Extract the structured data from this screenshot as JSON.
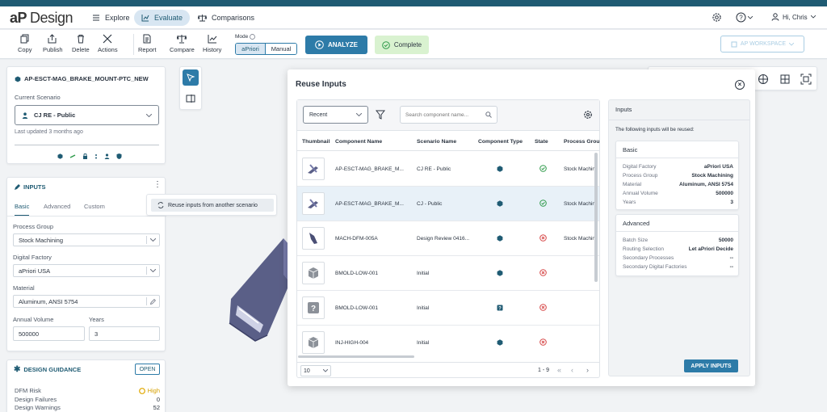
{
  "app": {
    "logo_mark": "aP",
    "logo_text": "Design",
    "nav": [
      {
        "label": "Explore"
      },
      {
        "label": "Evaluate"
      },
      {
        "label": "Comparisons"
      }
    ],
    "user_greeting": "Hi, Chris"
  },
  "toolbar": {
    "copy": "Copy",
    "publish": "Publish",
    "delete": "Delete",
    "actions": "Actions",
    "report": "Report",
    "compare": "Compare",
    "history": "History",
    "mode_label": "Mode",
    "mode_apriori": "aPriori",
    "mode_manual": "Manual",
    "analyze": "ANALYZE",
    "complete": "Complete",
    "workspace": "AP WORKSPACE"
  },
  "left": {
    "component_name": "AP-ESCT-MAG_BRAKE_MOUNT-PTC_NEW",
    "current_scenario_label": "Current Scenario",
    "scenario_value": "CJ RE - Public",
    "last_updated": "Last updated 3 months ago",
    "inputs_title": "INPUTS",
    "tabs": [
      "Basic",
      "Advanced",
      "Custom"
    ],
    "process_group_label": "Process Group",
    "process_group_value": "Stock Machining",
    "digital_factory_label": "Digital Factory",
    "digital_factory_value": "aPriori USA",
    "material_label": "Material",
    "material_value": "Aluminum, ANSI 5754",
    "annual_volume_label": "Annual Volume",
    "annual_volume_value": "500000",
    "years_label": "Years",
    "years_value": "3",
    "reuse_menu_item": "Reuse inputs from another scenario",
    "guidance_title": "DESIGN GUIDANCE",
    "guidance_open": "OPEN",
    "dfm_risk_label": "DFM Risk",
    "dfm_risk_value": "High",
    "design_failures_label": "Design Failures",
    "design_failures_value": "0",
    "design_warnings_label": "Design Warnings",
    "design_warnings_value": "52"
  },
  "modal": {
    "title": "Reuse Inputs",
    "filter_select": "Recent",
    "search_placeholder": "Search component name...",
    "columns": [
      "Thumbnail",
      "Component Name",
      "Scenario Name",
      "Component Type",
      "State",
      "Process Group"
    ],
    "rows": [
      {
        "name": "AP-ESCT-MAG_BRAKE_M...",
        "scenario": "CJ RE - Public",
        "state": "ok",
        "process": "Stock Machining",
        "thumb": "bracket-icon"
      },
      {
        "name": "AP-ESCT-MAG_BRAKE_M...",
        "scenario": "CJ - Public",
        "state": "ok",
        "process": "Stock Machining",
        "thumb": "bracket-icon"
      },
      {
        "name": "MACH-DFM-005A",
        "scenario": "Design Review 0416...",
        "state": "error",
        "process": "Stock Machining",
        "thumb": "part-icon"
      },
      {
        "name": "BMOLD-LOW-001",
        "scenario": "Initial",
        "state": "error",
        "process": "",
        "thumb": "box-icon"
      },
      {
        "name": "BMOLD-LOW-001",
        "scenario": "Initial",
        "state": "error",
        "process": "",
        "thumb": "unknown-icon"
      },
      {
        "name": "INJ-HIGH-004",
        "scenario": "Initial",
        "state": "error",
        "process": "",
        "thumb": "box-icon"
      }
    ],
    "page_size": "10",
    "page_range": "1 - 9",
    "inputs_panel_title": "Inputs",
    "inputs_panel_note": "The following inputs will be reused:",
    "basic_title": "Basic",
    "basic": [
      {
        "k": "Digital Factory",
        "v": "aPriori USA"
      },
      {
        "k": "Process Group",
        "v": "Stock Machining"
      },
      {
        "k": "Material",
        "v": "Aluminum, ANSI 5754"
      },
      {
        "k": "Annual Volume",
        "v": "500000"
      },
      {
        "k": "Years",
        "v": "3"
      }
    ],
    "advanced_title": "Advanced",
    "advanced": [
      {
        "k": "Batch Size",
        "v": "50000"
      },
      {
        "k": "Routing Selection",
        "v": "Let aPriori Decide"
      },
      {
        "k": "Secondary Processes",
        "v": "--"
      },
      {
        "k": "Secondary Digital Factories",
        "v": "--"
      }
    ],
    "apply": "APPLY INPUTS"
  },
  "colors": {
    "brand": "#1f5b73",
    "accent": "#2d7ba8",
    "complete_bg": "#d9f2d0",
    "ok": "#2e9a4a",
    "error": "#d64545"
  }
}
